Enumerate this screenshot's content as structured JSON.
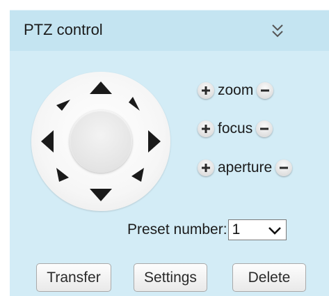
{
  "panel": {
    "title": "PTZ control",
    "collapse_icon": "double-chevron-down-icon"
  },
  "joystick": {
    "directions": [
      "up",
      "up-right",
      "right",
      "down-right",
      "down",
      "down-left",
      "left",
      "up-left"
    ]
  },
  "lens_controls": [
    {
      "label": "zoom",
      "plus_icon": "plus-icon",
      "minus_icon": "minus-icon"
    },
    {
      "label": "focus",
      "plus_icon": "plus-icon",
      "minus_icon": "minus-icon"
    },
    {
      "label": "aperture",
      "plus_icon": "plus-icon",
      "minus_icon": "minus-icon"
    }
  ],
  "preset": {
    "label": "Preset number:",
    "selected": "1"
  },
  "buttons": {
    "transfer": "Transfer",
    "settings": "Settings",
    "delete": "Delete"
  },
  "colors": {
    "panel_bg": "#d3ecf6",
    "header_bg": "#c4e4f1",
    "arrow": "#1a1a1a"
  }
}
